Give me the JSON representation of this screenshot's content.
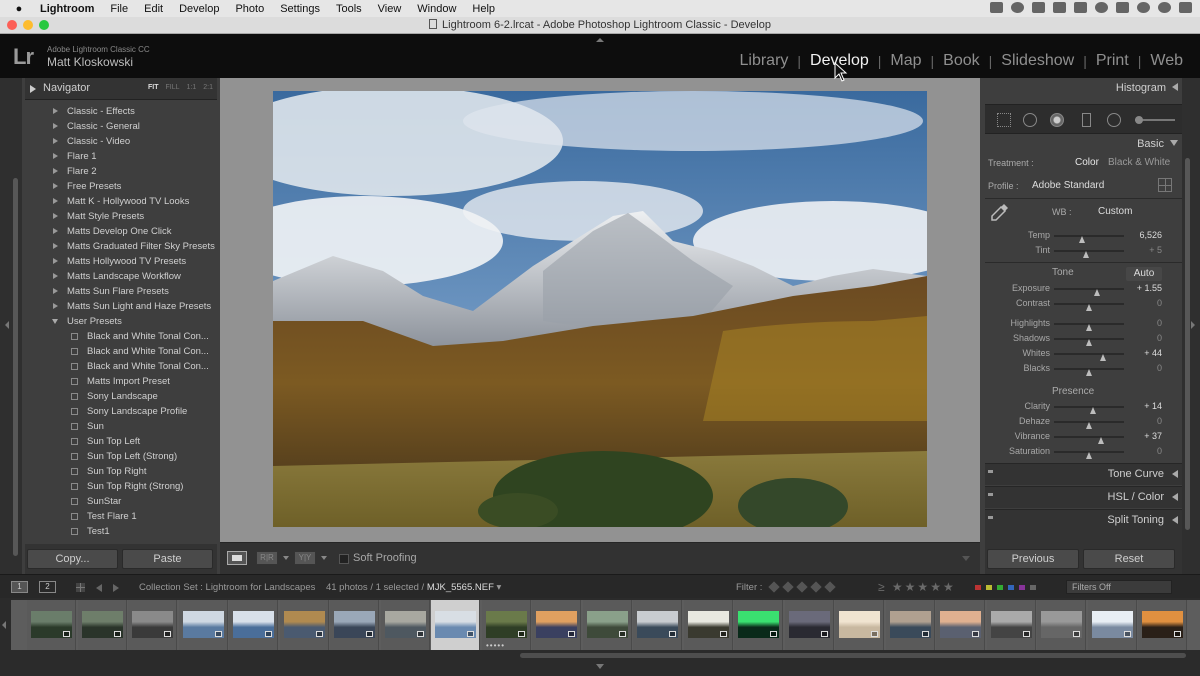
{
  "menubar": {
    "app": "Lightroom",
    "items": [
      "File",
      "Edit",
      "Develop",
      "Photo",
      "Settings",
      "Tools",
      "View",
      "Window",
      "Help"
    ]
  },
  "window": {
    "title": "Lightroom 6-2.lrcat - Adobe Photoshop Lightroom Classic - Develop"
  },
  "identity": {
    "logo": "Lr",
    "app_name": "Adobe Lightroom Classic CC",
    "user_name": "Matt Kloskowski"
  },
  "modules": [
    "Library",
    "Develop",
    "Map",
    "Book",
    "Slideshow",
    "Print",
    "Web"
  ],
  "active_module": "Develop",
  "navigator": {
    "title": "Navigator",
    "zoom_options": [
      "FIT",
      "FILL",
      "1:1",
      "2:1"
    ]
  },
  "presets": [
    {
      "label": "Classic - Effects",
      "type": "folder"
    },
    {
      "label": "Classic - General",
      "type": "folder"
    },
    {
      "label": "Classic - Video",
      "type": "folder"
    },
    {
      "label": "Flare 1",
      "type": "folder"
    },
    {
      "label": "Flare 2",
      "type": "folder"
    },
    {
      "label": "Free Presets",
      "type": "folder"
    },
    {
      "label": "Matt K - Hollywood TV Looks",
      "type": "folder"
    },
    {
      "label": "Matt Style Presets",
      "type": "folder"
    },
    {
      "label": "Matts Develop One Click",
      "type": "folder"
    },
    {
      "label": "Matts Graduated Filter Sky Presets",
      "type": "folder"
    },
    {
      "label": "Matts Hollywood TV Presets",
      "type": "folder"
    },
    {
      "label": "Matts Landscape Workflow",
      "type": "folder"
    },
    {
      "label": "Matts Sun Flare Presets",
      "type": "folder"
    },
    {
      "label": "Matts Sun Light and Haze Presets",
      "type": "folder"
    },
    {
      "label": "User Presets",
      "type": "folder-open"
    },
    {
      "label": "Black and White Tonal Con...",
      "type": "preset"
    },
    {
      "label": "Black and White Tonal Con...",
      "type": "preset"
    },
    {
      "label": "Black and White Tonal Con...",
      "type": "preset"
    },
    {
      "label": "Matts Import Preset",
      "type": "preset"
    },
    {
      "label": "Sony Landscape",
      "type": "preset"
    },
    {
      "label": "Sony Landscape Profile",
      "type": "preset"
    },
    {
      "label": "Sun",
      "type": "preset"
    },
    {
      "label": "Sun Top Left",
      "type": "preset"
    },
    {
      "label": "Sun Top Left (Strong)",
      "type": "preset"
    },
    {
      "label": "Sun Top Right",
      "type": "preset"
    },
    {
      "label": "Sun Top Right (Strong)",
      "type": "preset"
    },
    {
      "label": "SunStar",
      "type": "preset"
    },
    {
      "label": "Test Flare 1",
      "type": "preset"
    },
    {
      "label": "Test1",
      "type": "preset"
    }
  ],
  "left_buttons": {
    "copy": "Copy...",
    "paste": "Paste"
  },
  "toolbar": {
    "compare_a": "R|R",
    "compare_b": "Y|Y",
    "soft_proofing": "Soft Proofing"
  },
  "right": {
    "histogram": "Histogram",
    "basic": "Basic",
    "treatment_label": "Treatment :",
    "treatment_color": "Color",
    "treatment_bw": "Black & White",
    "profile_label": "Profile :",
    "profile_value": "Adobe Standard",
    "wb_label": "WB :",
    "wb_value": "Custom",
    "tone_title": "Tone",
    "auto": "Auto",
    "presence_title": "Presence",
    "collapsed": [
      "Tone Curve",
      "HSL / Color",
      "Split Toning"
    ],
    "prev": "Previous",
    "reset": "Reset"
  },
  "sliders": {
    "wb": [
      {
        "label": "Temp",
        "display": "6,526",
        "pos": 0.4,
        "changed": true
      },
      {
        "label": "Tint",
        "display": "+ 5",
        "pos": 0.46,
        "changed": false
      }
    ],
    "tone": [
      {
        "label": "Exposure",
        "display": "+ 1.55",
        "pos": 0.61,
        "changed": true
      },
      {
        "label": "Contrast",
        "display": "0",
        "pos": 0.5,
        "changed": false
      },
      {
        "label": "Highlights",
        "display": "0",
        "pos": 0.5,
        "changed": false
      },
      {
        "label": "Shadows",
        "display": "0",
        "pos": 0.5,
        "changed": false
      },
      {
        "label": "Whites",
        "display": "+ 44",
        "pos": 0.7,
        "changed": true
      },
      {
        "label": "Blacks",
        "display": "0",
        "pos": 0.5,
        "changed": false
      }
    ],
    "presence": [
      {
        "label": "Clarity",
        "display": "+ 14",
        "pos": 0.55,
        "changed": true
      },
      {
        "label": "Dehaze",
        "display": "0",
        "pos": 0.5,
        "changed": false
      },
      {
        "label": "Vibrance",
        "display": "+ 37",
        "pos": 0.67,
        "changed": true
      },
      {
        "label": "Saturation",
        "display": "0",
        "pos": 0.5,
        "changed": false
      }
    ]
  },
  "filmstrip": {
    "screen_1": "1",
    "screen_2": "2",
    "source": "Collection Set : Lightroom for Landscapes",
    "count": "41 photos / 1 selected /",
    "filename": "MJK_5565.NEF",
    "filter_label": "Filter :",
    "filters_off": "Filters Off",
    "selected_index": 8,
    "thumb_count": 23
  },
  "colors": {
    "accent_active": "#f2f2f2",
    "panel_bg": "#3e3e3e",
    "center_bg": "#929292"
  }
}
